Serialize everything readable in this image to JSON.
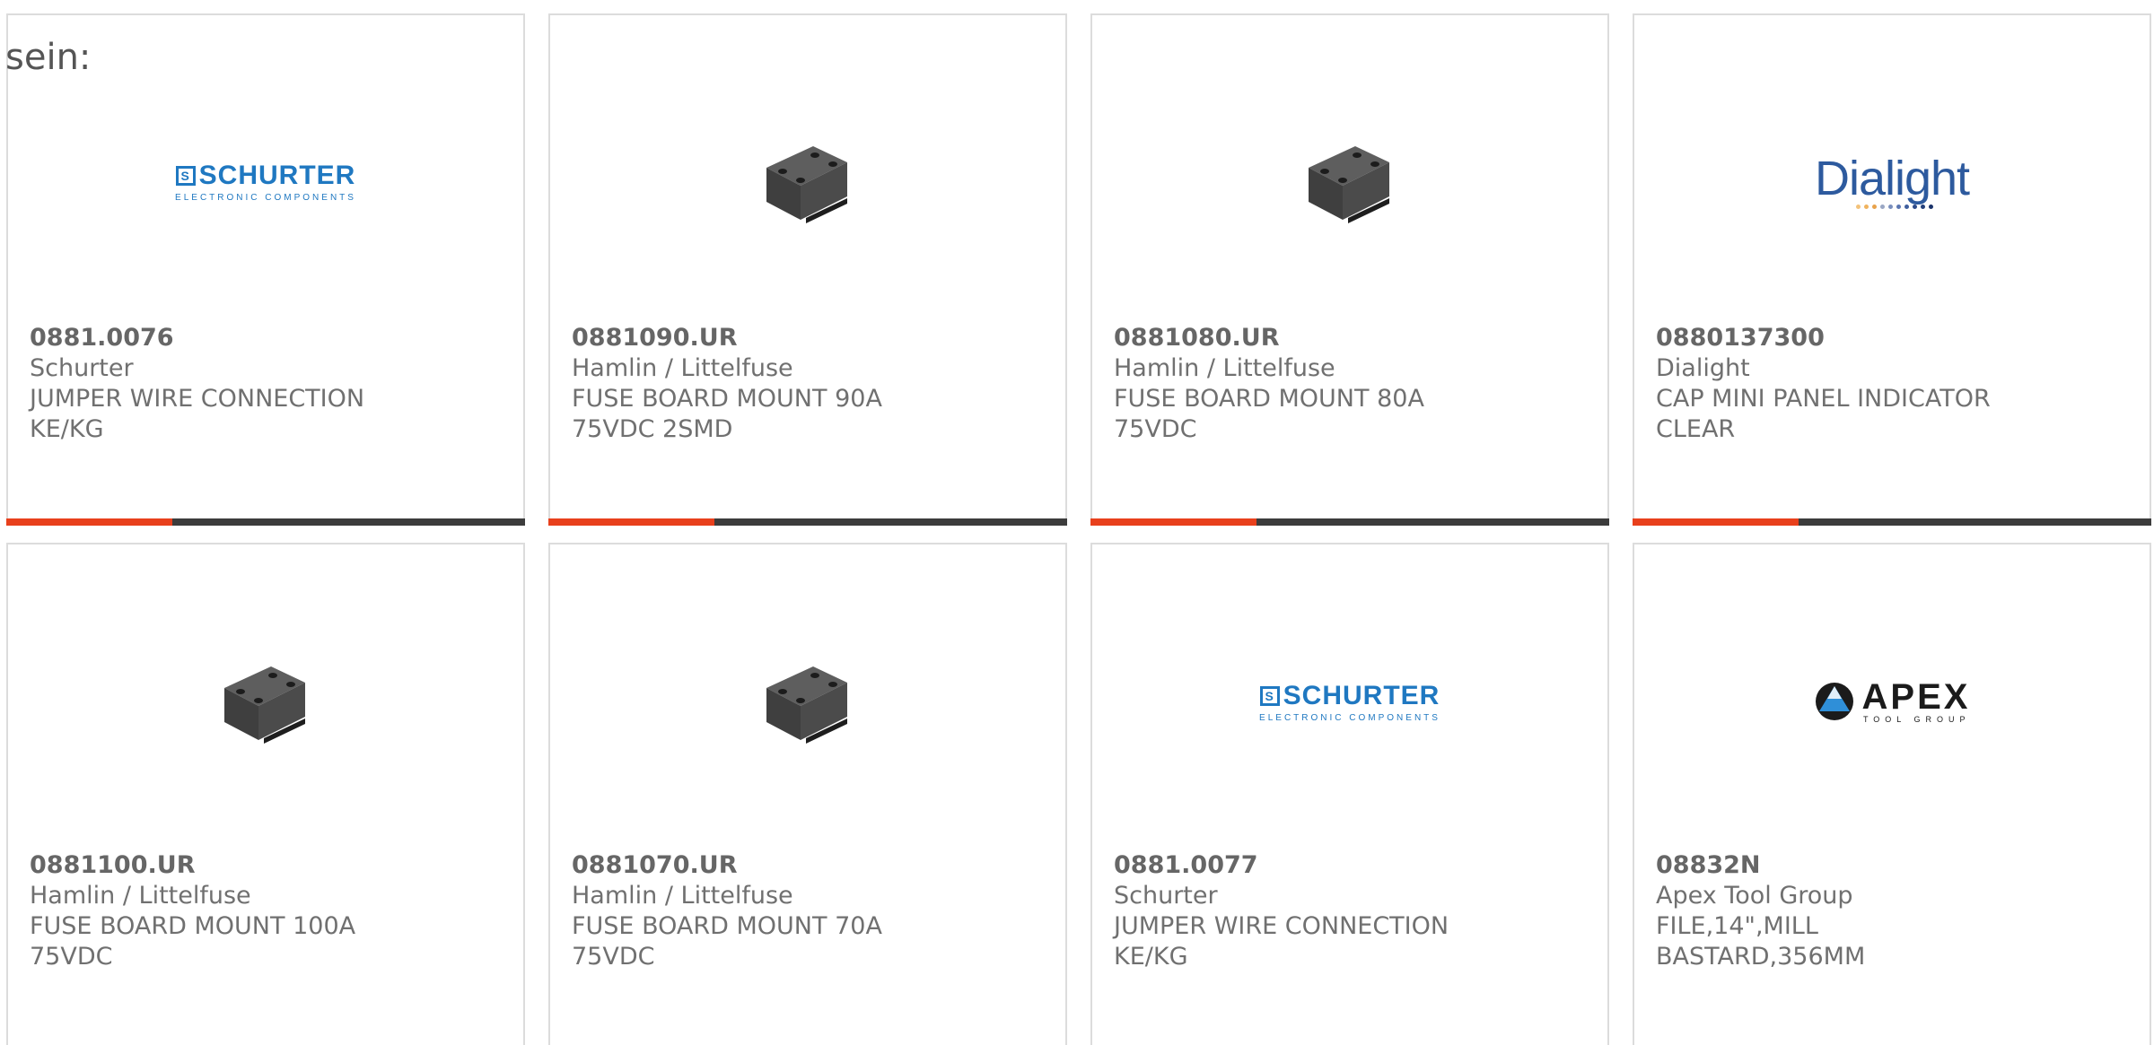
{
  "intro_text": "sein:",
  "colors": {
    "accent": "#e8401c",
    "bar": "#3c3c3c",
    "card_border": "#dcdcdc",
    "schurter_blue": "#1f78c1",
    "dialight_blue": "#2d5a9e",
    "apex_black": "#1b1b1b"
  },
  "products": [
    {
      "part_number": "0881.0076",
      "manufacturer": "Schurter",
      "description": "JUMPER WIRE CONNECTION KE/KG",
      "image": "schurter-logo",
      "accent_progress": 0.32
    },
    {
      "part_number": "0881090.UR",
      "manufacturer": "Hamlin / Littelfuse",
      "description": "FUSE BOARD MOUNT 90A 75VDC 2SMD",
      "image": "fuse-component-photo",
      "accent_progress": 0.32
    },
    {
      "part_number": "0881080.UR",
      "manufacturer": "Hamlin / Littelfuse",
      "description": "FUSE BOARD MOUNT 80A 75VDC",
      "image": "fuse-component-photo",
      "accent_progress": 0.32
    },
    {
      "part_number": "0880137300",
      "manufacturer": "Dialight",
      "description": "CAP MINI PANEL INDICATOR CLEAR",
      "image": "dialight-logo",
      "accent_progress": 0.32
    },
    {
      "part_number": "0881100.UR",
      "manufacturer": "Hamlin / Littelfuse",
      "description": "FUSE BOARD MOUNT 100A 75VDC",
      "image": "fuse-component-photo"
    },
    {
      "part_number": "0881070.UR",
      "manufacturer": "Hamlin / Littelfuse",
      "description": "FUSE BOARD MOUNT 70A 75VDC",
      "image": "fuse-component-photo"
    },
    {
      "part_number": "0881.0077",
      "manufacturer": "Schurter",
      "description": "JUMPER WIRE CONNECTION KE/KG",
      "image": "schurter-logo"
    },
    {
      "part_number": "08832N",
      "manufacturer": "Apex Tool Group",
      "description": "FILE,14\",MILL BASTARD,356MM",
      "image": "apex-logo"
    }
  ],
  "logos": {
    "schurter": {
      "symbol": "S",
      "wordmark": "SCHURTER",
      "tagline": "ELECTRONIC COMPONENTS"
    },
    "dialight": {
      "wordmark": "Dialight"
    },
    "apex": {
      "wordmark": "APEX",
      "tagline": "TOOL GROUP"
    }
  }
}
